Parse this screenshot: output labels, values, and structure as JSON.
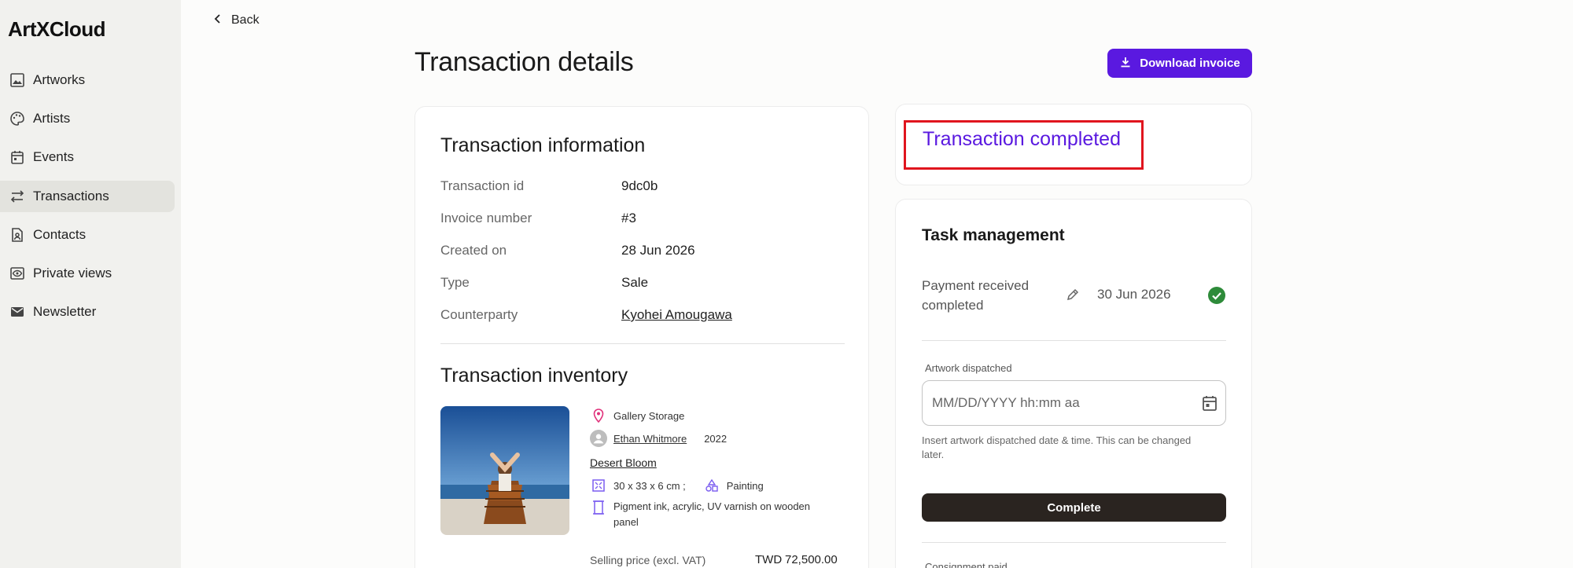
{
  "sidebar": {
    "logo": "ArtXCloud",
    "items": [
      {
        "label": "Artworks",
        "icon": "image-icon"
      },
      {
        "label": "Artists",
        "icon": "palette-icon"
      },
      {
        "label": "Events",
        "icon": "calendar-icon"
      },
      {
        "label": "Transactions",
        "icon": "swap-icon",
        "active": true
      },
      {
        "label": "Contacts",
        "icon": "contact-icon"
      },
      {
        "label": "Private views",
        "icon": "eye-icon"
      },
      {
        "label": "Newsletter",
        "icon": "mail-icon"
      }
    ]
  },
  "header": {
    "back_label": "Back",
    "title": "Transaction details",
    "download_label": "Download invoice"
  },
  "transaction_info": {
    "title": "Transaction information",
    "rows": [
      {
        "label": "Transaction id",
        "value": "9dc0b"
      },
      {
        "label": "Invoice number",
        "value": "#3"
      },
      {
        "label": "Created on",
        "value": "28 Jun 2026"
      },
      {
        "label": "Type",
        "value": "Sale"
      },
      {
        "label": "Counterparty",
        "value": "Kyohei Amougawa"
      }
    ]
  },
  "inventory": {
    "title": "Transaction inventory",
    "location": "Gallery Storage",
    "artist": "Ethan Whitmore",
    "year": "2022",
    "artwork_title": "Desert Bloom",
    "dimensions": "30 x 33 x 6 cm ;",
    "category": "Painting",
    "medium_line1": "Pigment ink, acrylic, UV varnish on wooden",
    "medium_line2": "panel",
    "price_label": "Selling price (excl. VAT)",
    "price_currency": "TWD",
    "price_value": "72,500.00"
  },
  "status": {
    "text": "Transaction completed"
  },
  "task": {
    "title": "Task management",
    "payment_label_line1": "Payment received",
    "payment_label_line2": "completed",
    "payment_date": "30 Jun 2026",
    "dispatch_label": "Artwork dispatched",
    "dispatch_placeholder": "MM/DD/YYYY hh:mm aa",
    "helper_line1": "Insert artwork dispatched date & time. This can be changed",
    "helper_line2": "later.",
    "complete_label": "Complete",
    "consignment_label": "Consignment paid"
  },
  "colors": {
    "accent": "#5a19e0",
    "highlight_border": "#e0151e",
    "success": "#2e8b3a",
    "dark_button": "#2a2420"
  }
}
